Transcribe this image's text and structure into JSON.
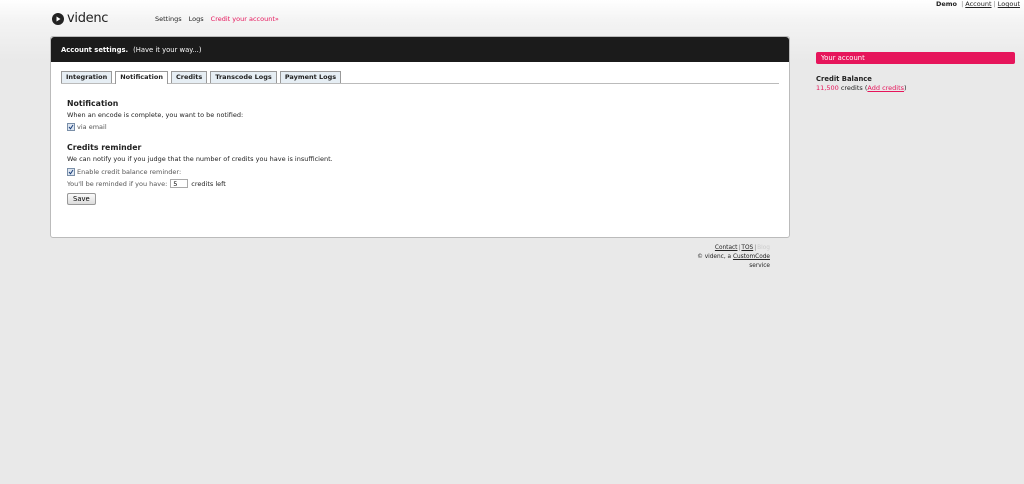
{
  "colors": {
    "accent": "#e6155b",
    "header_bg": "#1b1b1b"
  },
  "userbar": {
    "username": "Demo",
    "account": "Account",
    "logout": "Logout"
  },
  "logo": {
    "icon": "play-icon",
    "text": "videnc"
  },
  "topnav": {
    "settings": "Settings",
    "logs": "Logs",
    "credit": "Credit your account»"
  },
  "panel": {
    "title": "Account settings.",
    "subtitle": "(Have it your way...)",
    "tabs": [
      {
        "label": "Integration"
      },
      {
        "label": "Notification",
        "active": true
      },
      {
        "label": "Credits"
      },
      {
        "label": "Transcode Logs"
      },
      {
        "label": "Payment Logs"
      }
    ]
  },
  "notification": {
    "heading": "Notification",
    "description": "When an encode is complete, you want to be notified:",
    "via_email_label": "via email",
    "via_email_checked": true
  },
  "reminder": {
    "heading": "Credits reminder",
    "description": "We can notify you if you judge that the number of credits you have is insufficient.",
    "enable_label": "Enable credit balance reminder:",
    "enable_checked": true,
    "remind_label": "You'll be reminded if you have:",
    "remind_value": "5",
    "remind_suffix": "credits left"
  },
  "save_label": "Save",
  "footer": {
    "contact": "Contact",
    "tos": "TOS",
    "faded": "Blog",
    "copyright_prefix": "© videnc, a",
    "company": "CustomCode",
    "copyright_suffix": "service"
  },
  "sidebar": {
    "title": "Your account",
    "balance_label": "Credit Balance",
    "balance_value": "11,500",
    "credits_word": "credits",
    "add_credits": "Add credits"
  }
}
